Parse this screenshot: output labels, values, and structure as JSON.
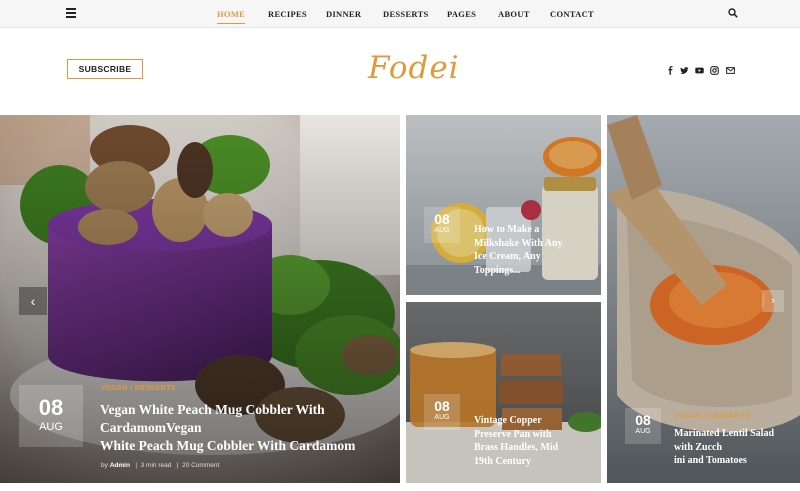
{
  "nav": {
    "items": [
      "HOME",
      "RECIPES",
      "DINNER",
      "DESSERTS",
      "PAGES",
      "ABOUT",
      "CONTACT"
    ],
    "active": "HOME"
  },
  "header": {
    "subscribe_label": "SUBSCRIBE",
    "logo": "Fodei",
    "social_icons": [
      "facebook-icon",
      "twitter-icon",
      "youtube-icon",
      "instagram-icon",
      "mail-icon"
    ]
  },
  "posts": {
    "featured": {
      "day": "08",
      "month": "AUG",
      "categories": "VEGAN  /  DESSERTS",
      "title_line1": "Vegan White Peach Mug Cobbler With",
      "title_line2": "CardamomVegan",
      "title_line3": "White Peach Mug Cobbler With Cardamom",
      "meta_by": "by",
      "meta_author": "Admin",
      "meta_read": "3 min read",
      "meta_comments": "20 Comment"
    },
    "milkshake": {
      "day": "08",
      "month": "AUG",
      "title_line1": "How to Make a",
      "title_line2": "Milkshake With Any",
      "title_line3": "Ice Cream, Any",
      "title_line4": "Toppings..."
    },
    "tea": {
      "day": "08",
      "month": "AUG",
      "title_line1": "Vintage Copper",
      "title_line2": "Preserve Pan with",
      "title_line3": "Brass Handles, Mid",
      "title_line4": "19th Century"
    },
    "lentil": {
      "day": "08",
      "month": "AUG",
      "categories": "VEGAN  /  DESSERTS",
      "title_line1": "Marinated Lentil Salad",
      "title_line2": "with Zucch",
      "title_line3": "ini and Tomatoes"
    }
  },
  "colors": {
    "accent": "#e09a3a",
    "purple": "#6b2f86",
    "topbar": "#f6f6f6"
  }
}
